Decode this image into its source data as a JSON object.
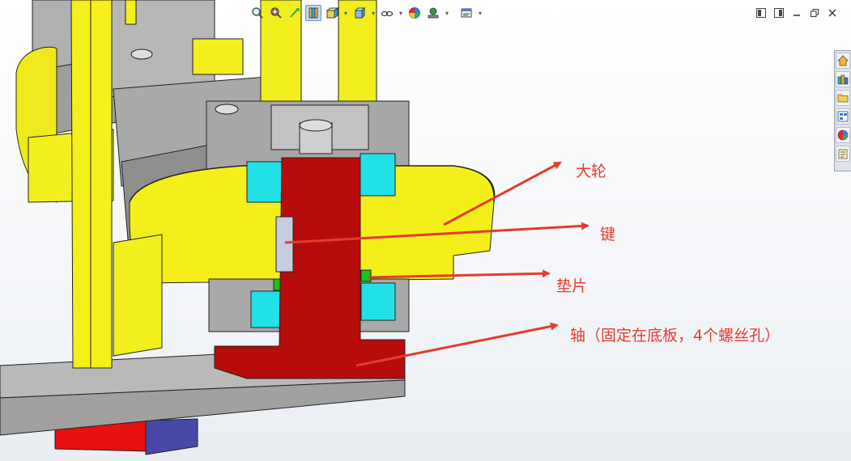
{
  "annotations": {
    "big_wheel": "大轮",
    "key": "键",
    "washer": "垫片",
    "shaft": "轴（固定在底板，4个螺丝孔）"
  },
  "toolbar": {
    "items": [
      "zoom-to-fit",
      "zoom-to-area",
      "previous-view",
      "section-view",
      "view-orientation",
      "display-style",
      "hide-show-items",
      "edit-appearance",
      "apply-scene",
      "view-settings"
    ]
  },
  "window_controls": [
    "tile-left",
    "tile-right",
    "minimize",
    "restore",
    "close"
  ],
  "colors": {
    "annotation_red": "#e53b2e",
    "part_yellow": "#f3ee1e",
    "part_red": "#b80c0c",
    "part_cyan": "#22e1e6",
    "part_gray": "#b7b7b7",
    "part_green": "#1ac51a",
    "part_blue": "#4a4aa6"
  }
}
